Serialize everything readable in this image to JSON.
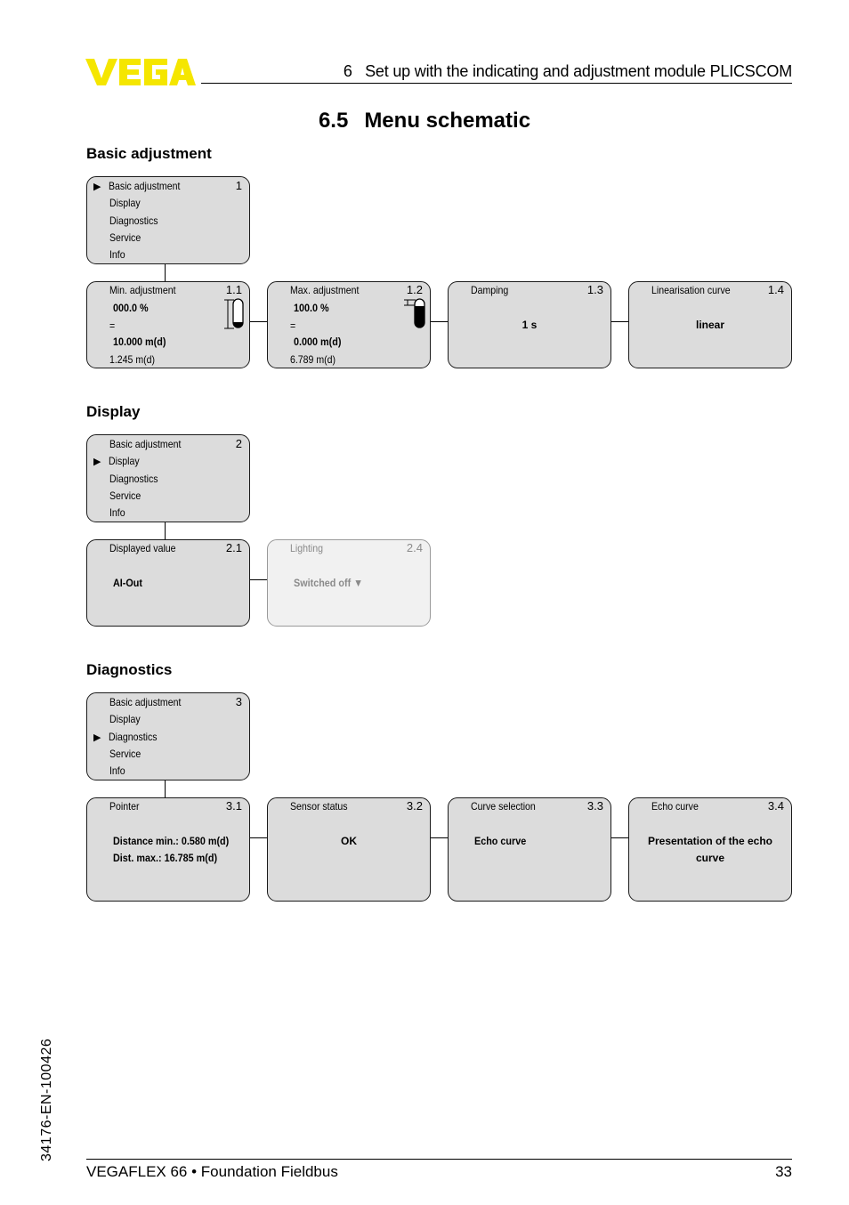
{
  "brand": {
    "logo_text": "VEGA",
    "logo_color": "#f5e600"
  },
  "header": {
    "chapter": "6",
    "title": "Set up with the indicating and adjustment module PLICSCOM"
  },
  "section": {
    "number": "6.5",
    "title": "Menu schematic"
  },
  "main_menu_items": [
    "Basic adjustment",
    "Display",
    "Diagnostics",
    "Service",
    "Info"
  ],
  "groups": {
    "basic": {
      "heading": "Basic adjustment",
      "menu": {
        "selected_index": 0,
        "number": "1",
        "pointer": "▶"
      },
      "boxes": [
        {
          "label": "Min. adjustment",
          "number": "1.1",
          "value_percent": "000.0 %",
          "equals": "=",
          "value_distance": "10.000 m(d)",
          "measured": "1.245 m(d)",
          "icon": "min-level-gauge-icon"
        },
        {
          "label": "Max. adjustment",
          "number": "1.2",
          "value_percent": "100.0 %",
          "equals": "=",
          "value_distance": "0.000 m(d)",
          "measured": "6.789 m(d)",
          "icon": "max-level-gauge-icon"
        },
        {
          "label": "Damping",
          "number": "1.3",
          "value": "1 s"
        },
        {
          "label": "Linearisation curve",
          "number": "1.4",
          "value": "linear"
        }
      ]
    },
    "display": {
      "heading": "Display",
      "menu": {
        "selected_index": 1,
        "number": "2",
        "pointer": "▶"
      },
      "boxes": [
        {
          "label": "Displayed value",
          "number": "2.1",
          "value": "AI-Out"
        },
        {
          "label": "Lighting",
          "number": "2.4",
          "value": "Switched off",
          "dropdown_glyph": "▼",
          "disabled": true
        }
      ]
    },
    "diagnostics": {
      "heading": "Diagnostics",
      "menu": {
        "selected_index": 2,
        "number": "3",
        "pointer": "▶"
      },
      "boxes": [
        {
          "label": "Pointer",
          "number": "3.1",
          "line1": "Distance min.: 0.580 m(d)",
          "line2": "Dist. max.: 16.785 m(d)"
        },
        {
          "label": "Sensor status",
          "number": "3.2",
          "value": "OK"
        },
        {
          "label": "Curve selection",
          "number": "3.3",
          "value": "Echo curve"
        },
        {
          "label": "Echo curve",
          "number": "3.4",
          "line1": "Presentation of the echo",
          "line2": "curve"
        }
      ]
    }
  },
  "footer": {
    "product": "VEGAFLEX 66 • Foundation Fieldbus",
    "page": "33",
    "doc_id": "34176-EN-100426"
  }
}
